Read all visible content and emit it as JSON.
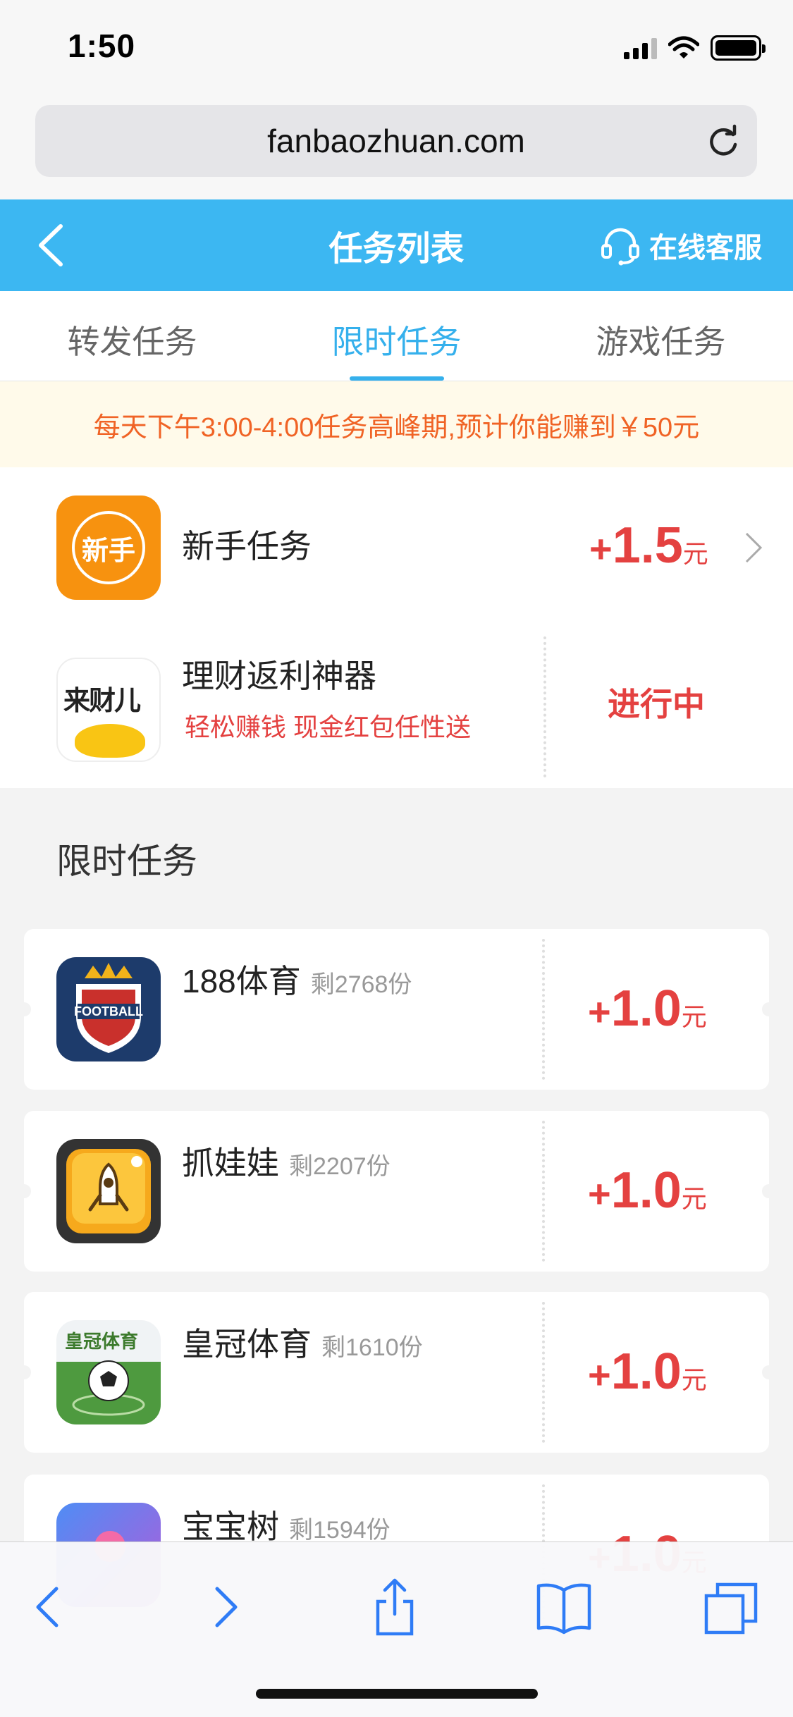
{
  "status_bar": {
    "time": "1:50"
  },
  "browser": {
    "url": "fanbaozhuan.com"
  },
  "header": {
    "title": "任务列表",
    "customer_service": "在线客服"
  },
  "tabs": [
    {
      "label": "转发任务",
      "active": false
    },
    {
      "label": "限时任务",
      "active": true
    },
    {
      "label": "游戏任务",
      "active": false
    }
  ],
  "notice": "每天下午3:00-4:00任务高峰期,预计你能赚到￥50元",
  "newbie_task": {
    "icon_text": "新手",
    "name": "新手任务",
    "reward_plus": "+",
    "reward_value": "1.5",
    "reward_unit": "元"
  },
  "finance_task": {
    "icon_text": "来财儿",
    "name": "理财返利神器",
    "subtitle": "轻松赚钱 现金红包任性送",
    "status": "进行中"
  },
  "section_title": "限时任务",
  "tasks": [
    {
      "name": "188体育",
      "remain": "剩2768份",
      "plus": "+",
      "value": "1.0",
      "unit": "元",
      "icon": "football-shield-icon"
    },
    {
      "name": "抓娃娃",
      "remain": "剩2207份",
      "plus": "+",
      "value": "1.0",
      "unit": "元",
      "icon": "claw-machine-icon"
    },
    {
      "name": "皇冠体育",
      "remain": "剩1610份",
      "plus": "+",
      "value": "1.0",
      "unit": "元",
      "icon": "soccer-ball-icon",
      "icon_text": "皇冠体育"
    },
    {
      "name": "宝宝树",
      "remain": "剩1594份",
      "plus": "+",
      "value": "1.0",
      "unit": "元",
      "icon": "baby-tree-icon"
    }
  ],
  "colors": {
    "header": "#3cb7f2",
    "accent": "#35b0ec",
    "reward": "#e44140",
    "notice_text": "#f06325",
    "notice_bg": "#fffaea"
  }
}
